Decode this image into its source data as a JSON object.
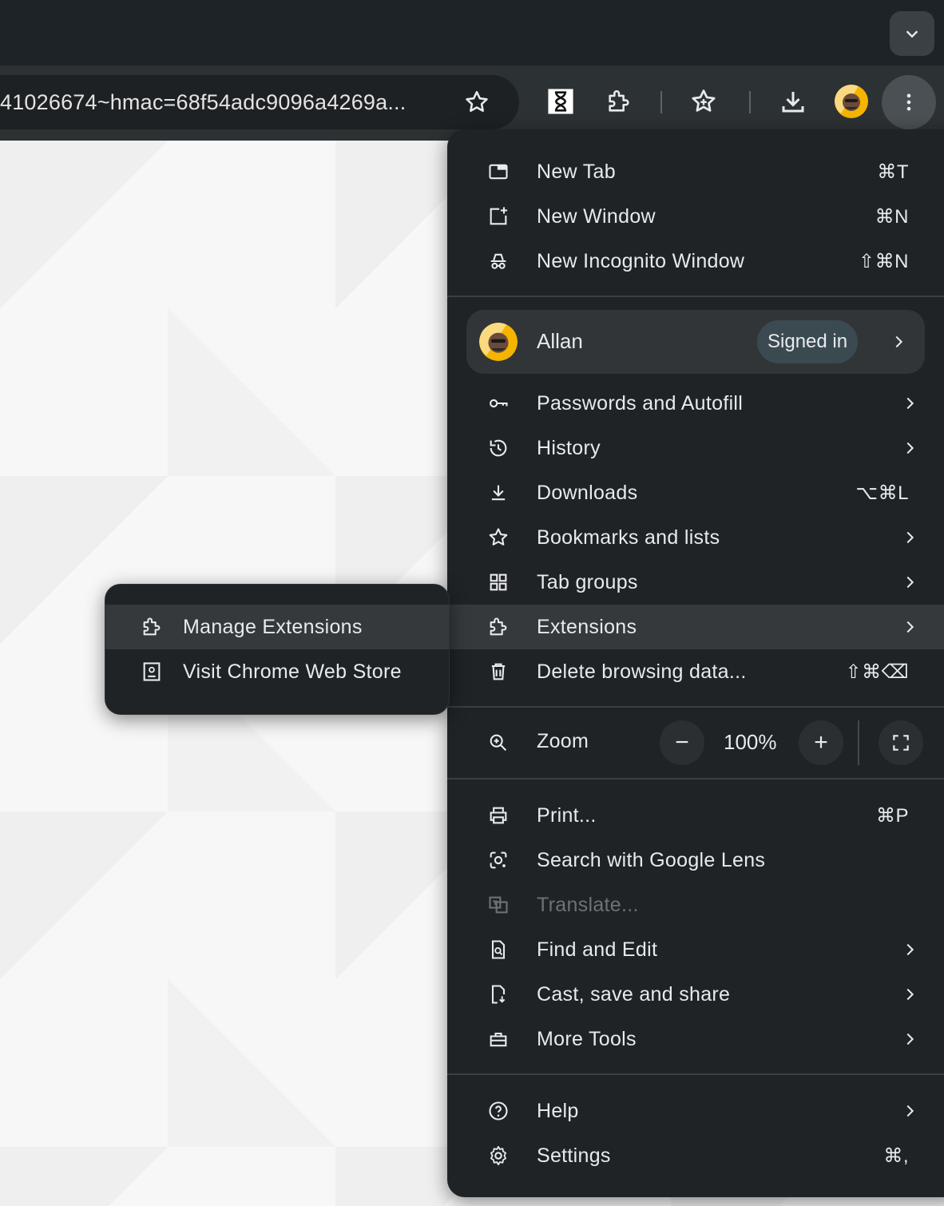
{
  "browser": {
    "url_text": "41026674~hmac=68f54adc9096a4269a...",
    "profile_name": "Allan"
  },
  "menu": {
    "top_items": [
      {
        "label": "New Tab",
        "shortcut": "⌘T",
        "icon": "new-tab-icon"
      },
      {
        "label": "New Window",
        "shortcut": "⌘N",
        "icon": "new-window-icon"
      },
      {
        "label": "New Incognito Window",
        "shortcut": "⇧⌘N",
        "icon": "incognito-icon"
      }
    ],
    "profile": {
      "name": "Allan",
      "status": "Signed in"
    },
    "items": [
      {
        "label": "Passwords and Autofill",
        "shortcut": "",
        "submenu": true,
        "icon": "key-icon"
      },
      {
        "label": "History",
        "shortcut": "",
        "submenu": true,
        "icon": "history-icon"
      },
      {
        "label": "Downloads",
        "shortcut": "⌥⌘L",
        "submenu": false,
        "icon": "download-icon"
      },
      {
        "label": "Bookmarks and lists",
        "shortcut": "",
        "submenu": true,
        "icon": "star-icon"
      },
      {
        "label": "Tab groups",
        "shortcut": "",
        "submenu": true,
        "icon": "tab-groups-icon"
      },
      {
        "label": "Extensions",
        "shortcut": "",
        "submenu": true,
        "icon": "extension-icon",
        "highlighted": true
      },
      {
        "label": "Delete browsing data...",
        "shortcut": "⇧⌘⌫",
        "submenu": false,
        "icon": "trash-icon"
      }
    ],
    "zoom": {
      "label": "Zoom",
      "value": "100%",
      "minus": "−",
      "plus": "+"
    },
    "tools_items": [
      {
        "label": "Print...",
        "shortcut": "⌘P",
        "icon": "print-icon"
      },
      {
        "label": "Search with Google Lens",
        "shortcut": "",
        "icon": "lens-icon"
      },
      {
        "label": "Translate...",
        "shortcut": "",
        "icon": "translate-icon",
        "disabled": true
      },
      {
        "label": "Find and Edit",
        "shortcut": "",
        "submenu": true,
        "icon": "find-icon"
      },
      {
        "label": "Cast, save and share",
        "shortcut": "",
        "submenu": true,
        "icon": "cast-icon"
      },
      {
        "label": "More Tools",
        "shortcut": "",
        "submenu": true,
        "icon": "toolbox-icon"
      }
    ],
    "bottom_items": [
      {
        "label": "Help",
        "shortcut": "",
        "submenu": true,
        "icon": "help-icon"
      },
      {
        "label": "Settings",
        "shortcut": "⌘,",
        "icon": "settings-icon"
      }
    ]
  },
  "submenu": {
    "items": [
      {
        "label": "Manage Extensions",
        "icon": "extension-icon",
        "highlighted": true
      },
      {
        "label": "Visit Chrome Web Store",
        "icon": "web-store-icon"
      }
    ]
  },
  "colors": {
    "menu_bg": "#1f2326",
    "highlight": "#35393c",
    "signed_in_chip": "#3b4a50",
    "toolbar": "#2c3134"
  }
}
